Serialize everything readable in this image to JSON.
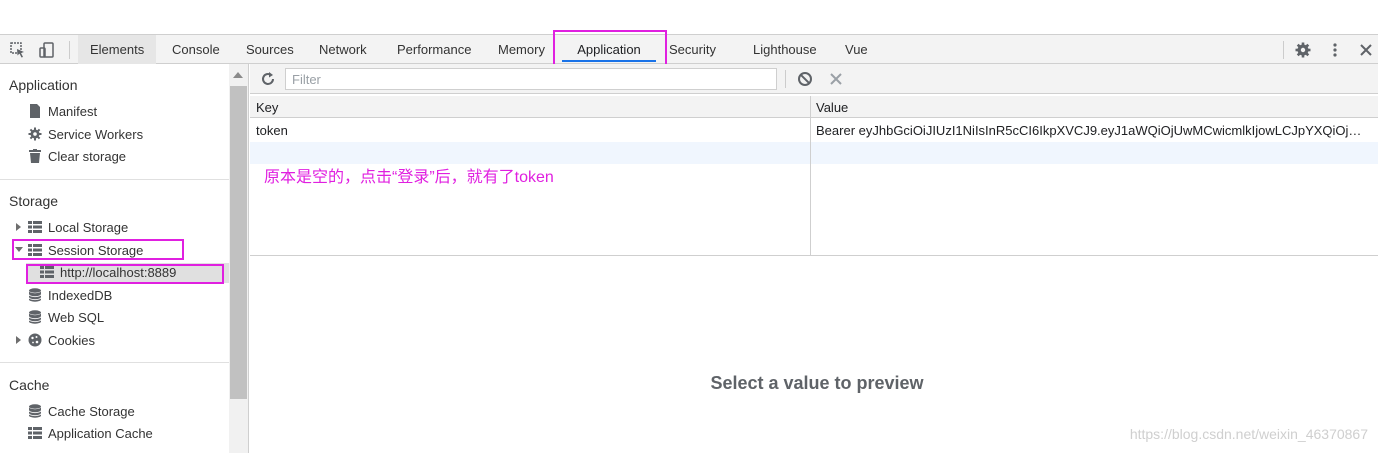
{
  "toolbar": {
    "tabs": [
      "Elements",
      "Console",
      "Sources",
      "Network",
      "Performance",
      "Memory",
      "Application",
      "Security",
      "Lighthouse",
      "Vue"
    ],
    "active_tab": "Application",
    "icons": [
      "inspect-element-icon",
      "device-toolbar-icon",
      "gear-icon",
      "more-vertical-icon",
      "close-icon"
    ]
  },
  "sidebar": {
    "sections": [
      {
        "title": "Application",
        "items": [
          "Manifest",
          "Service Workers",
          "Clear storage"
        ]
      },
      {
        "title": "Storage",
        "items": [
          "Local Storage",
          "Session Storage",
          "http://localhost:8889",
          "IndexedDB",
          "Web SQL",
          "Cookies"
        ]
      },
      {
        "title": "Cache",
        "items": [
          "Cache Storage",
          "Application Cache"
        ]
      }
    ],
    "selected_item": "http://localhost:8889"
  },
  "filterbar": {
    "placeholder": "Filter",
    "icons": [
      "refresh-icon",
      "clear-all-icon",
      "delete-selected-icon"
    ]
  },
  "table": {
    "columns": [
      "Key",
      "Value"
    ],
    "rows": [
      {
        "key": "token",
        "value": "Bearer eyJhbGciOiJIUzI1NiIsInR5cCI6IkpXVCJ9.eyJ1aWQiOjUwMCwicmlkIjowLCJpYXQiOjE2..."
      }
    ]
  },
  "annotation": "原本是空的，点击“登录”后，就有了token",
  "preview": {
    "text": "Select a value to preview"
  },
  "watermark": "https://blog.csdn.net/weixin_46370867",
  "colors": {
    "highlight": "#e020e0",
    "accent": "#1a73e8",
    "row_alt": "#f0f6fe"
  }
}
